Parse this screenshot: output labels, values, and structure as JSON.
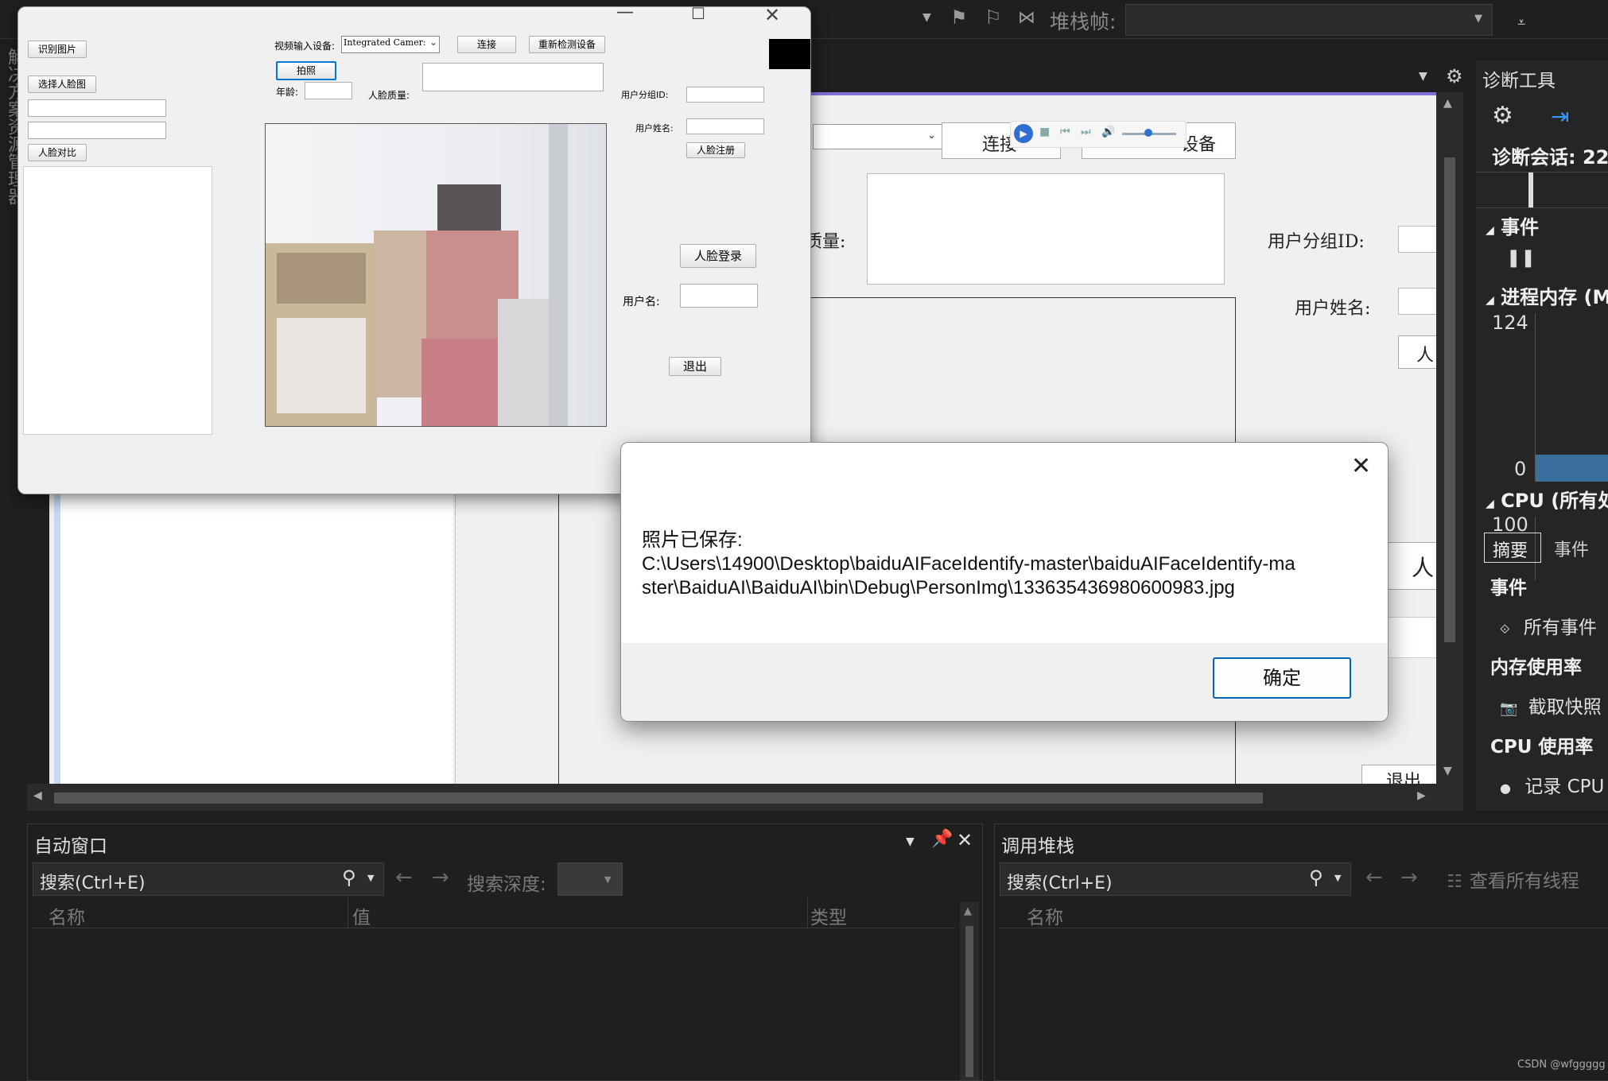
{
  "vs_toolbar": {
    "stack_frame_label": "堆栈帧:"
  },
  "diag": {
    "title": "诊断工具",
    "session": "诊断会话: 22",
    "events_section": "事件",
    "memory_section": "进程内存 (M",
    "memory_max": "124",
    "memory_min": "0",
    "cpu_section": "CPU (所有处",
    "cpu_max": "100",
    "tabs": [
      "摘要",
      "事件"
    ],
    "list": {
      "events_header": "事件",
      "all_events": "所有事件",
      "memory_header": "内存使用率",
      "snapshot": "截取快照",
      "cpu_header": "CPU 使用率",
      "record_cpu": "记录 CPU"
    }
  },
  "left_gutter_text": "解决方案资源管理器",
  "auto_window": {
    "title": "自动窗口",
    "search_placeholder": "搜索(Ctrl+E)",
    "search_depth_label": "搜索深度:",
    "columns": [
      "名称",
      "值",
      "类型"
    ]
  },
  "call_stack": {
    "title": "调用堆栈",
    "search_placeholder": "搜索(Ctrl+E)",
    "show_threads": "查看所有线程",
    "columns": [
      "名称"
    ]
  },
  "designer_bg": {
    "connect": "连接",
    "redetect_suffix": "设备",
    "face_quality_partial": "质量:",
    "group_id": "用户分组ID:",
    "user_name": "用户姓名:",
    "partial_btn": "人",
    "partial_btn2": "人",
    "partial_exit": "退出"
  },
  "face_app": {
    "recognize_image": "识别图片",
    "select_face_image": "选择人脸图",
    "face_compare": "人脸对比",
    "video_device_label": "视频输入设备:",
    "video_device_value": "Integrated Camer:",
    "connect": "连接",
    "redetect": "重新检测设备",
    "capture": "拍照",
    "age_label": "年龄:",
    "face_quality_label": "人脸质量:",
    "group_id_label": "用户分组ID:",
    "user_name_label": "用户姓名:",
    "register": "人脸注册",
    "login": "人脸登录",
    "username_label": "用户名:",
    "exit": "退出"
  },
  "dialog": {
    "message_title": "照片已保存:",
    "message_path_line1": "C:\\Users\\14900\\Desktop\\baiduAIFaceIdentify-master\\baiduAIFaceIdentify-ma",
    "message_path_line2": "ster\\BaiduAI\\BaiduAI\\bin\\Debug\\PersonImg\\133635436980600983.jpg",
    "ok": "确定"
  },
  "watermark": "CSDN @wfggggg",
  "colors": {
    "accent": "#0067c0",
    "vs_bg": "#1f1f1f",
    "vs_panel": "#252526"
  }
}
